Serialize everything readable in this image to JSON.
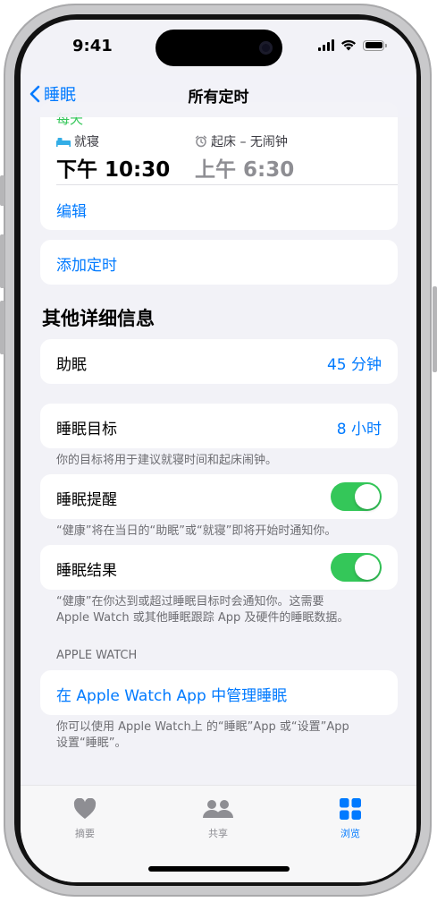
{
  "status": {
    "time": "9:41"
  },
  "nav": {
    "back_label": "睡眠",
    "title": "所有定时"
  },
  "schedule": {
    "repeat_label": "每天",
    "bedtime_label": "就寝",
    "bedtime_value": "下午 10:30",
    "wake_label": "起床 – 无闹钟",
    "wake_value": "上午 6:30",
    "edit_label": "编辑"
  },
  "add_schedule": {
    "label": "添加定时"
  },
  "section_title": "其他详细信息",
  "wind_down": {
    "label": "助眠",
    "value": "45 分钟"
  },
  "sleep_goal": {
    "label": "睡眠目标",
    "value": "8 小时",
    "footer": "你的目标将用于建议就寝时间和起床闹钟。"
  },
  "sleep_reminders": {
    "label": "睡眠提醒",
    "enabled": true,
    "footer": "“健康”将在当日的“助眠”或“就寝”即将开始时通知你。"
  },
  "sleep_results": {
    "label": "睡眠结果",
    "enabled": true,
    "footer_line1": "“健康”在你达到或超过睡眠目标时会通知你。这需要",
    "footer_line2": "Apple Watch 或其他睡眠跟踪 App 及硬件的睡眠数据。"
  },
  "apple_watch": {
    "header": "APPLE WATCH",
    "manage_label": "在 Apple Watch App 中管理睡眠",
    "footer_line1": "你可以使用 Apple Watch上 的“睡眠”App 或“设置”App",
    "footer_line2": "设置“睡眠”。"
  },
  "tabs": [
    {
      "label": "摘要",
      "icon": "heart-icon",
      "active": false
    },
    {
      "label": "共享",
      "icon": "people-icon",
      "active": false
    },
    {
      "label": "浏览",
      "icon": "grid-icon",
      "active": true
    }
  ],
  "colors": {
    "accent": "#007aff",
    "toggle_on": "#34c759",
    "bed_icon": "#32ade6",
    "background": "#f2f2f7"
  }
}
